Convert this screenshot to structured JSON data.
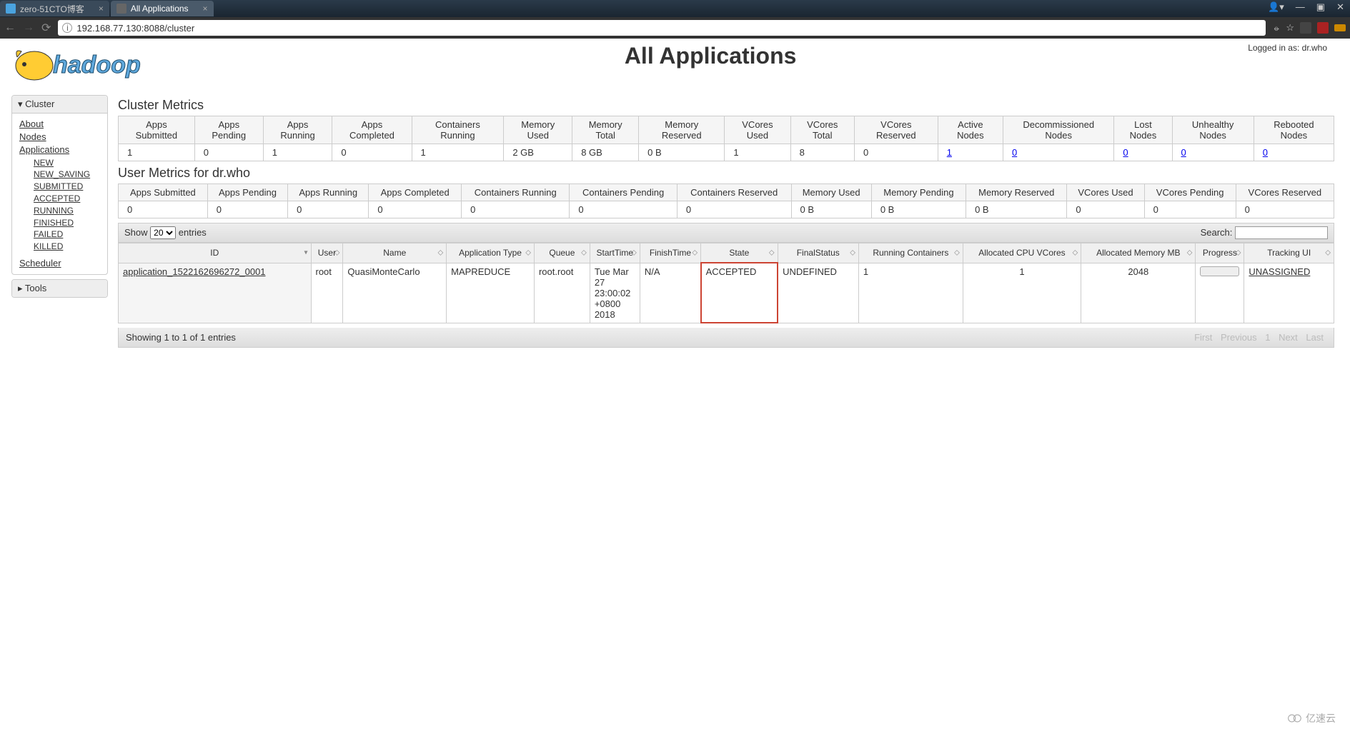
{
  "browser": {
    "tabs": [
      {
        "title": "zero-51CTO博客",
        "active": false
      },
      {
        "title": "All Applications",
        "active": true
      }
    ],
    "url": "192.168.77.130:8088/cluster"
  },
  "header": {
    "login_text": "Logged in as: dr.who",
    "page_title": "All Applications"
  },
  "sidebar": {
    "cluster_label": "Cluster",
    "tools_label": "Tools",
    "links": {
      "about": "About",
      "nodes": "Nodes",
      "applications": "Applications",
      "scheduler": "Scheduler"
    },
    "app_states": [
      "NEW",
      "NEW_SAVING",
      "SUBMITTED",
      "ACCEPTED",
      "RUNNING",
      "FINISHED",
      "FAILED",
      "KILLED"
    ]
  },
  "cluster_metrics": {
    "title": "Cluster Metrics",
    "headers": [
      "Apps Submitted",
      "Apps Pending",
      "Apps Running",
      "Apps Completed",
      "Containers Running",
      "Memory Used",
      "Memory Total",
      "Memory Reserved",
      "VCores Used",
      "VCores Total",
      "VCores Reserved",
      "Active Nodes",
      "Decommissioned Nodes",
      "Lost Nodes",
      "Unhealthy Nodes",
      "Rebooted Nodes"
    ],
    "values": [
      "1",
      "0",
      "1",
      "0",
      "1",
      "2 GB",
      "8 GB",
      "0 B",
      "1",
      "8",
      "0",
      "1",
      "0",
      "0",
      "0",
      "0"
    ]
  },
  "user_metrics": {
    "title": "User Metrics for dr.who",
    "headers": [
      "Apps Submitted",
      "Apps Pending",
      "Apps Running",
      "Apps Completed",
      "Containers Running",
      "Containers Pending",
      "Containers Reserved",
      "Memory Used",
      "Memory Pending",
      "Memory Reserved",
      "VCores Used",
      "VCores Pending",
      "VCores Reserved"
    ],
    "values": [
      "0",
      "0",
      "0",
      "0",
      "0",
      "0",
      "0",
      "0 B",
      "0 B",
      "0 B",
      "0",
      "0",
      "0"
    ]
  },
  "datatable": {
    "show_label": "Show",
    "entries_label": "entries",
    "length_value": "20",
    "search_label": "Search:",
    "columns": [
      "ID",
      "User",
      "Name",
      "Application Type",
      "Queue",
      "StartTime",
      "FinishTime",
      "State",
      "FinalStatus",
      "Running Containers",
      "Allocated CPU VCores",
      "Allocated Memory MB",
      "Progress",
      "Tracking UI"
    ],
    "row": {
      "id": "application_1522162696272_0001",
      "user": "root",
      "name": "QuasiMonteCarlo",
      "app_type": "MAPREDUCE",
      "queue": "root.root",
      "start_time": "Tue Mar 27 23:00:02 +0800 2018",
      "finish_time": "N/A",
      "state": "ACCEPTED",
      "final_status": "UNDEFINED",
      "running_containers": "1",
      "vcores": "1",
      "memory_mb": "2048",
      "tracking_ui": "UNASSIGNED"
    },
    "info_text": "Showing 1 to 1 of 1 entries",
    "pager": {
      "first": "First",
      "prev": "Previous",
      "page": "1",
      "next": "Next",
      "last": "Last"
    }
  },
  "watermark": "亿速云"
}
